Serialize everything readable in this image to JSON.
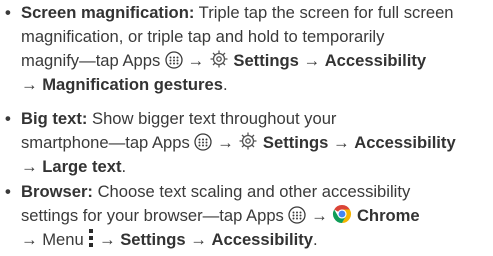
{
  "items": [
    {
      "title": "Screen magnification:",
      "line1_text": "Triple tap the screen for full screen",
      "line2_text": "magnification, or triple tap and hold to temporarily",
      "line3_text": "magnify—tap Apps",
      "settings": "Settings",
      "accessibility": "Accessibility",
      "final": "Magnification gestures",
      "end": "."
    },
    {
      "title": "Big text:",
      "line1_text": "Show bigger text throughout your",
      "line2_text": "smartphone—tap Apps",
      "settings": "Settings",
      "accessibility": "Accessibility",
      "final": "Large text",
      "end": "."
    },
    {
      "title": "Browser:",
      "line1_text": "Choose text scaling and other accessibility",
      "line2_text": "settings for your browser—tap Apps",
      "chrome": "Chrome",
      "menu": "Menu",
      "settings": "Settings",
      "accessibility": "Accessibility",
      "end": "."
    }
  ],
  "bullet": "•",
  "arrow": "→",
  "icons": {
    "apps": "apps-icon",
    "settings": "gear-icon",
    "chrome": "chrome-icon",
    "menu": "overflow-menu-icon"
  },
  "colors": {
    "text": "#3a3a3a",
    "chrome_red": "#db4437",
    "chrome_yellow": "#f4b400",
    "chrome_green": "#0f9d58",
    "chrome_blue": "#4285f4"
  }
}
